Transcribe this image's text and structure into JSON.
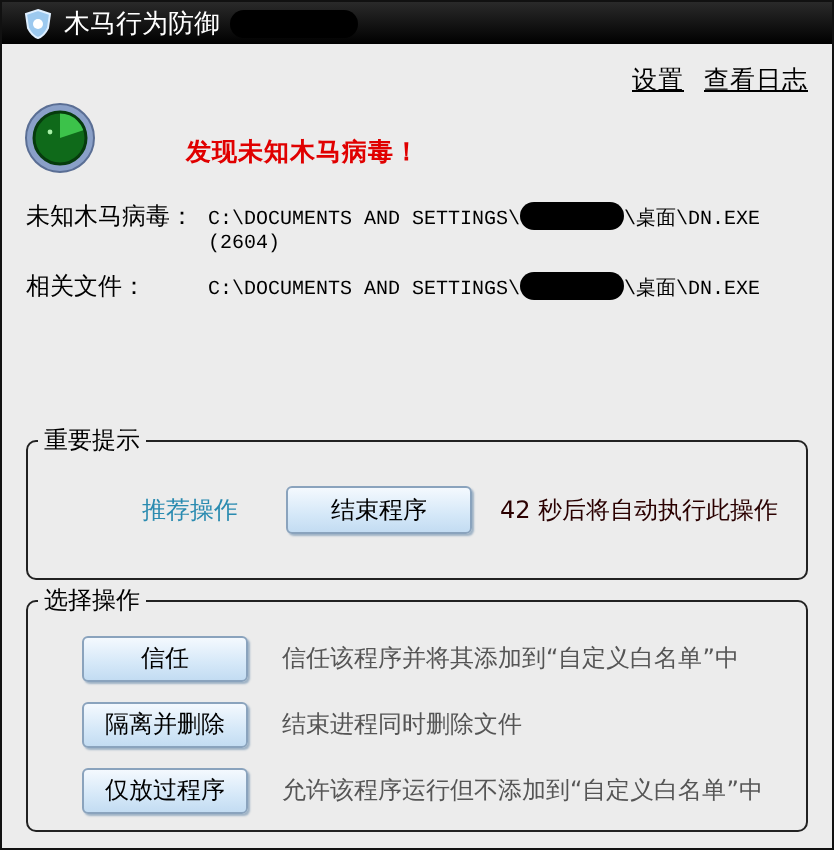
{
  "window": {
    "title": "木马行为防御"
  },
  "links": [
    "设置",
    "查看日志"
  ],
  "alert": "发现未知木马病毒！",
  "details": [
    {
      "label": "未知木马病毒：",
      "path_start": "C:\\DOCUMENTS AND SETTINGS\\",
      "path_end": "\\桌面\\DN.EXE",
      "pid": "(2604)"
    },
    {
      "label": "相关文件：",
      "path_start": "C:\\DOCUMENTS AND SETTINGS\\",
      "path_end": "\\桌面\\DN.EXE"
    }
  ],
  "important": {
    "title": "重要提示",
    "recommend_label": "推荐操作",
    "button": "结束程序",
    "countdown": "42 秒后将自动执行此操作"
  },
  "choices": {
    "title": "选择操作",
    "options": [
      {
        "button": "信任",
        "description": "信任该程序并将其添加到“自定义白名单”中"
      },
      {
        "button": "隔离并删除",
        "description": "结束进程同时删除文件"
      },
      {
        "button": "仅放过程序",
        "description": "允许该程序运行但不添加到“自定义白名单”中"
      }
    ]
  }
}
